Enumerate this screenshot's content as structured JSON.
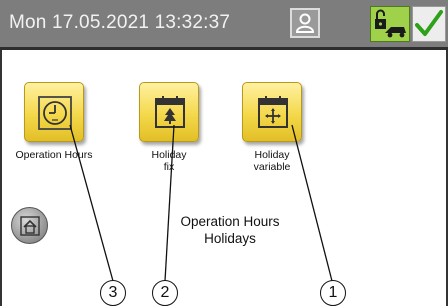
{
  "header": {
    "datetime": "Mon 17.05.2021  13:32:37",
    "bg_color": "#7d7d7d",
    "user_icon": "user-icon",
    "lock_status_icon": "lock-open-icon",
    "confirm_icon": "check-icon"
  },
  "tiles": [
    {
      "label": "Operation Hours",
      "icon": "clock-icon"
    },
    {
      "label": "Holiday\nfix",
      "icon": "calendar-tree-icon"
    },
    {
      "label": "Holiday\nvariable",
      "icon": "calendar-move-icon"
    }
  ],
  "home_icon": "home-icon",
  "screen_title": "Operation Hours\nHolidays",
  "callouts": [
    "3",
    "2",
    "1"
  ],
  "colors": {
    "tile_yellow": "#f4d84b",
    "lock_green": "#9fd24a",
    "check_green": "#2ea11a"
  }
}
